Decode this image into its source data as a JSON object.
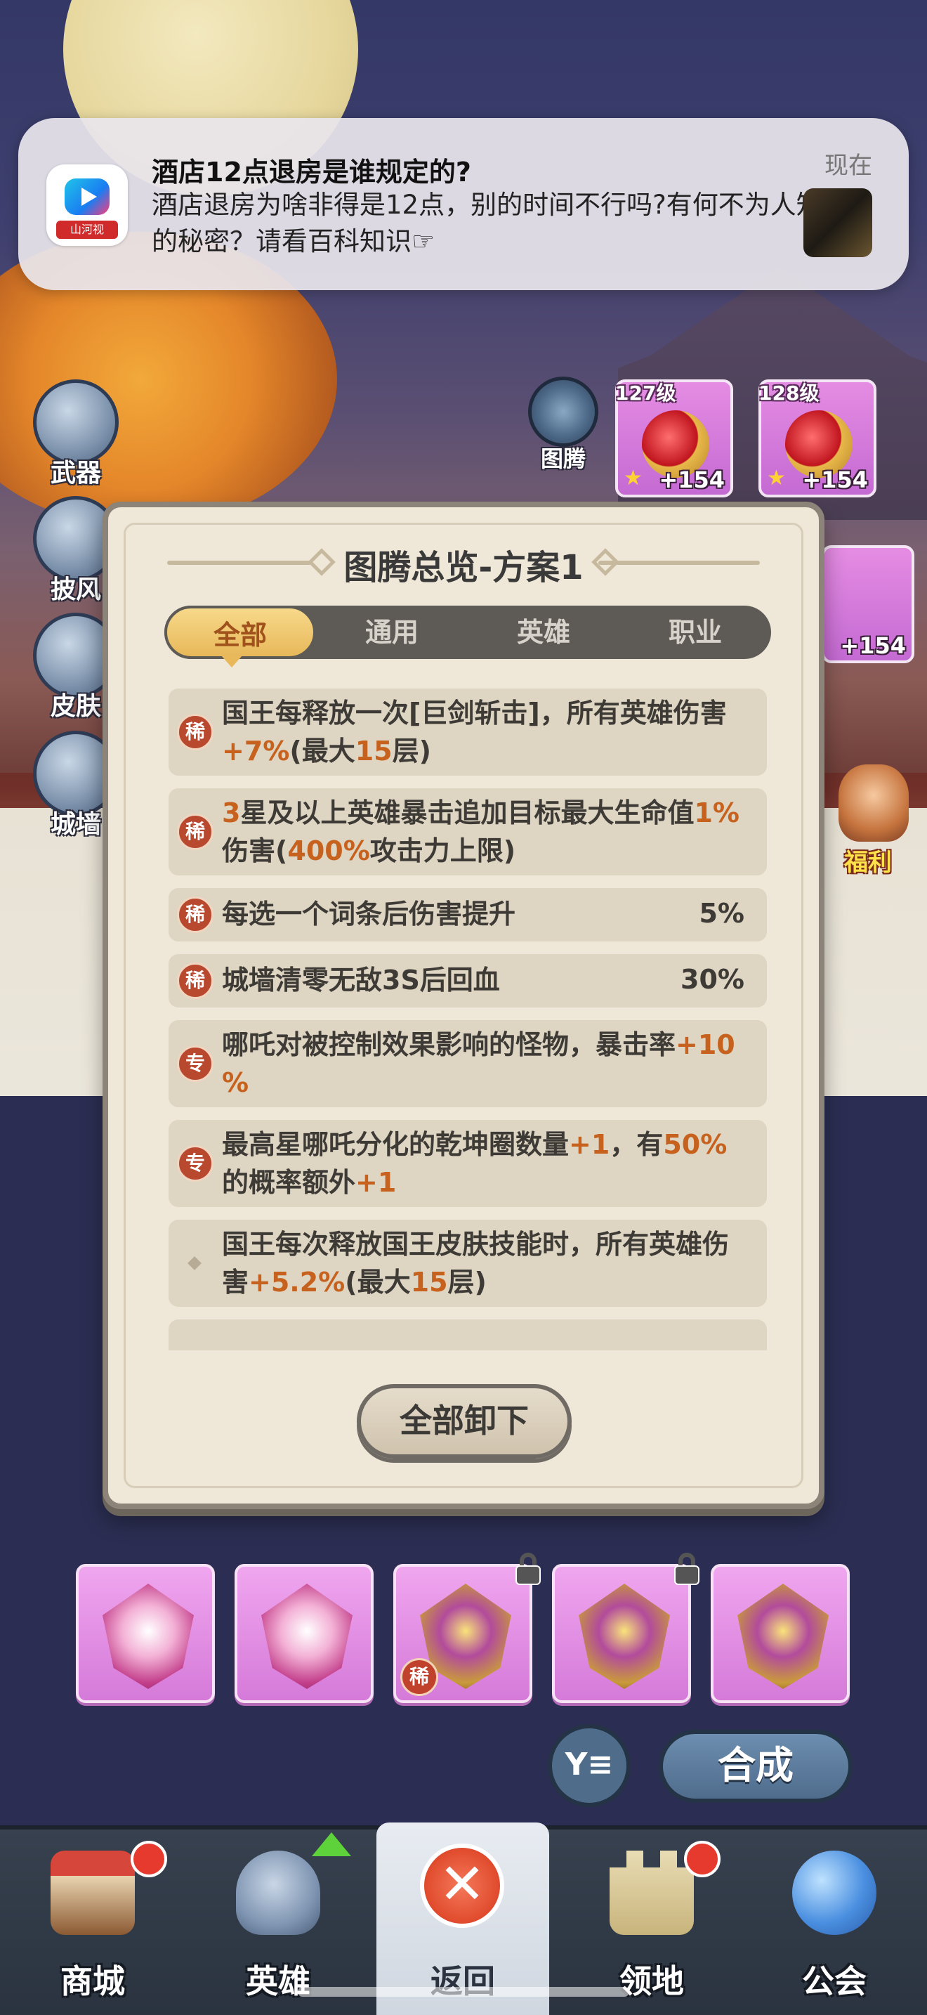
{
  "notification": {
    "title": "酒店12点退房是谁规定的?",
    "body": "酒店退房为啥非得是12点，别的时间不行吗?有何不为人知的秘密？请看百科知识☞",
    "time": "现在",
    "app_brand": "山河视"
  },
  "side_menu": [
    {
      "label": "武器",
      "icon": "helmet-icon"
    },
    {
      "label": "披风",
      "icon": "cape-icon"
    },
    {
      "label": "皮肤",
      "icon": "armor-icon"
    },
    {
      "label": "城墙",
      "icon": "castle-wall-icon"
    }
  ],
  "totem_button": {
    "label": "图腾"
  },
  "item_cards": [
    {
      "level": "127级",
      "bonus": "+154"
    },
    {
      "level": "128级",
      "bonus": "+154"
    },
    {
      "bonus": "+154"
    }
  ],
  "welfare": {
    "label": "福利"
  },
  "modal": {
    "title": "图腾总览-方案1",
    "tabs": [
      {
        "label": "全部",
        "active": true
      },
      {
        "label": "通用",
        "active": false
      },
      {
        "label": "英雄",
        "active": false
      },
      {
        "label": "职业",
        "active": false
      }
    ],
    "rows": [
      {
        "badge": "稀",
        "line1_a": "国王每释放一次[巨剑斩击]，所有英雄伤害",
        "line2_hl1": "+7%",
        "line2_b": "(最大",
        "line2_hl2": "15",
        "line2_c": "层)"
      },
      {
        "badge": "稀",
        "line1_hl1": "3",
        "line1_a": "星及以上英雄暴击追加目标最大生命值",
        "line1_hl2": "1%",
        "line2_a": "伤害(",
        "line2_hl1": "400%",
        "line2_b": "攻击力上限)"
      },
      {
        "badge": "稀",
        "text": "每选一个词条后伤害提升",
        "value": "5%"
      },
      {
        "badge": "稀",
        "text": "城墙清零无敌3S后回血",
        "value": "30%"
      },
      {
        "badge": "专",
        "line1_a": "哪吒对被控制效果影响的怪物，暴击率",
        "line1_hl1": "+10",
        "line2_hl1": "%"
      },
      {
        "badge": "专",
        "line1_a": "最高星哪吒分化的乾坤圈数量",
        "line1_hl1": "+1",
        "line1_b": "，有",
        "line1_hl2": "50%",
        "line2_a": "的概率额外",
        "line2_hl1": "+1"
      },
      {
        "badge": "",
        "line1_a": "国王每次释放国王皮肤技能时，所有英雄伤",
        "line2_a": "害",
        "line2_hl1": "+5.2%",
        "line2_b": "(最大",
        "line2_hl2": "15",
        "line2_c": "层)"
      }
    ],
    "unload_button": "全部卸下"
  },
  "grid": {
    "rare_badge": "稀",
    "filter_label": "Y≡",
    "compose_button": "合成"
  },
  "bottom_nav": [
    {
      "label": "商城",
      "icon": "shop-icon",
      "badge": true,
      "active": false
    },
    {
      "label": "英雄",
      "icon": "knight-helmet-icon",
      "badge": false,
      "active": false
    },
    {
      "label": "返回",
      "icon": "close-icon",
      "badge": false,
      "active": true
    },
    {
      "label": "领地",
      "icon": "castle-icon",
      "badge": true,
      "active": false
    },
    {
      "label": "公会",
      "icon": "planet-icon",
      "badge": false,
      "active": false
    }
  ],
  "colors": {
    "highlight": "#c7621e",
    "tab_active": "#e8b85a",
    "rare_badge": "#b8492f",
    "card_pink": "#d57ad9",
    "nav_bg": "#2a333f"
  }
}
